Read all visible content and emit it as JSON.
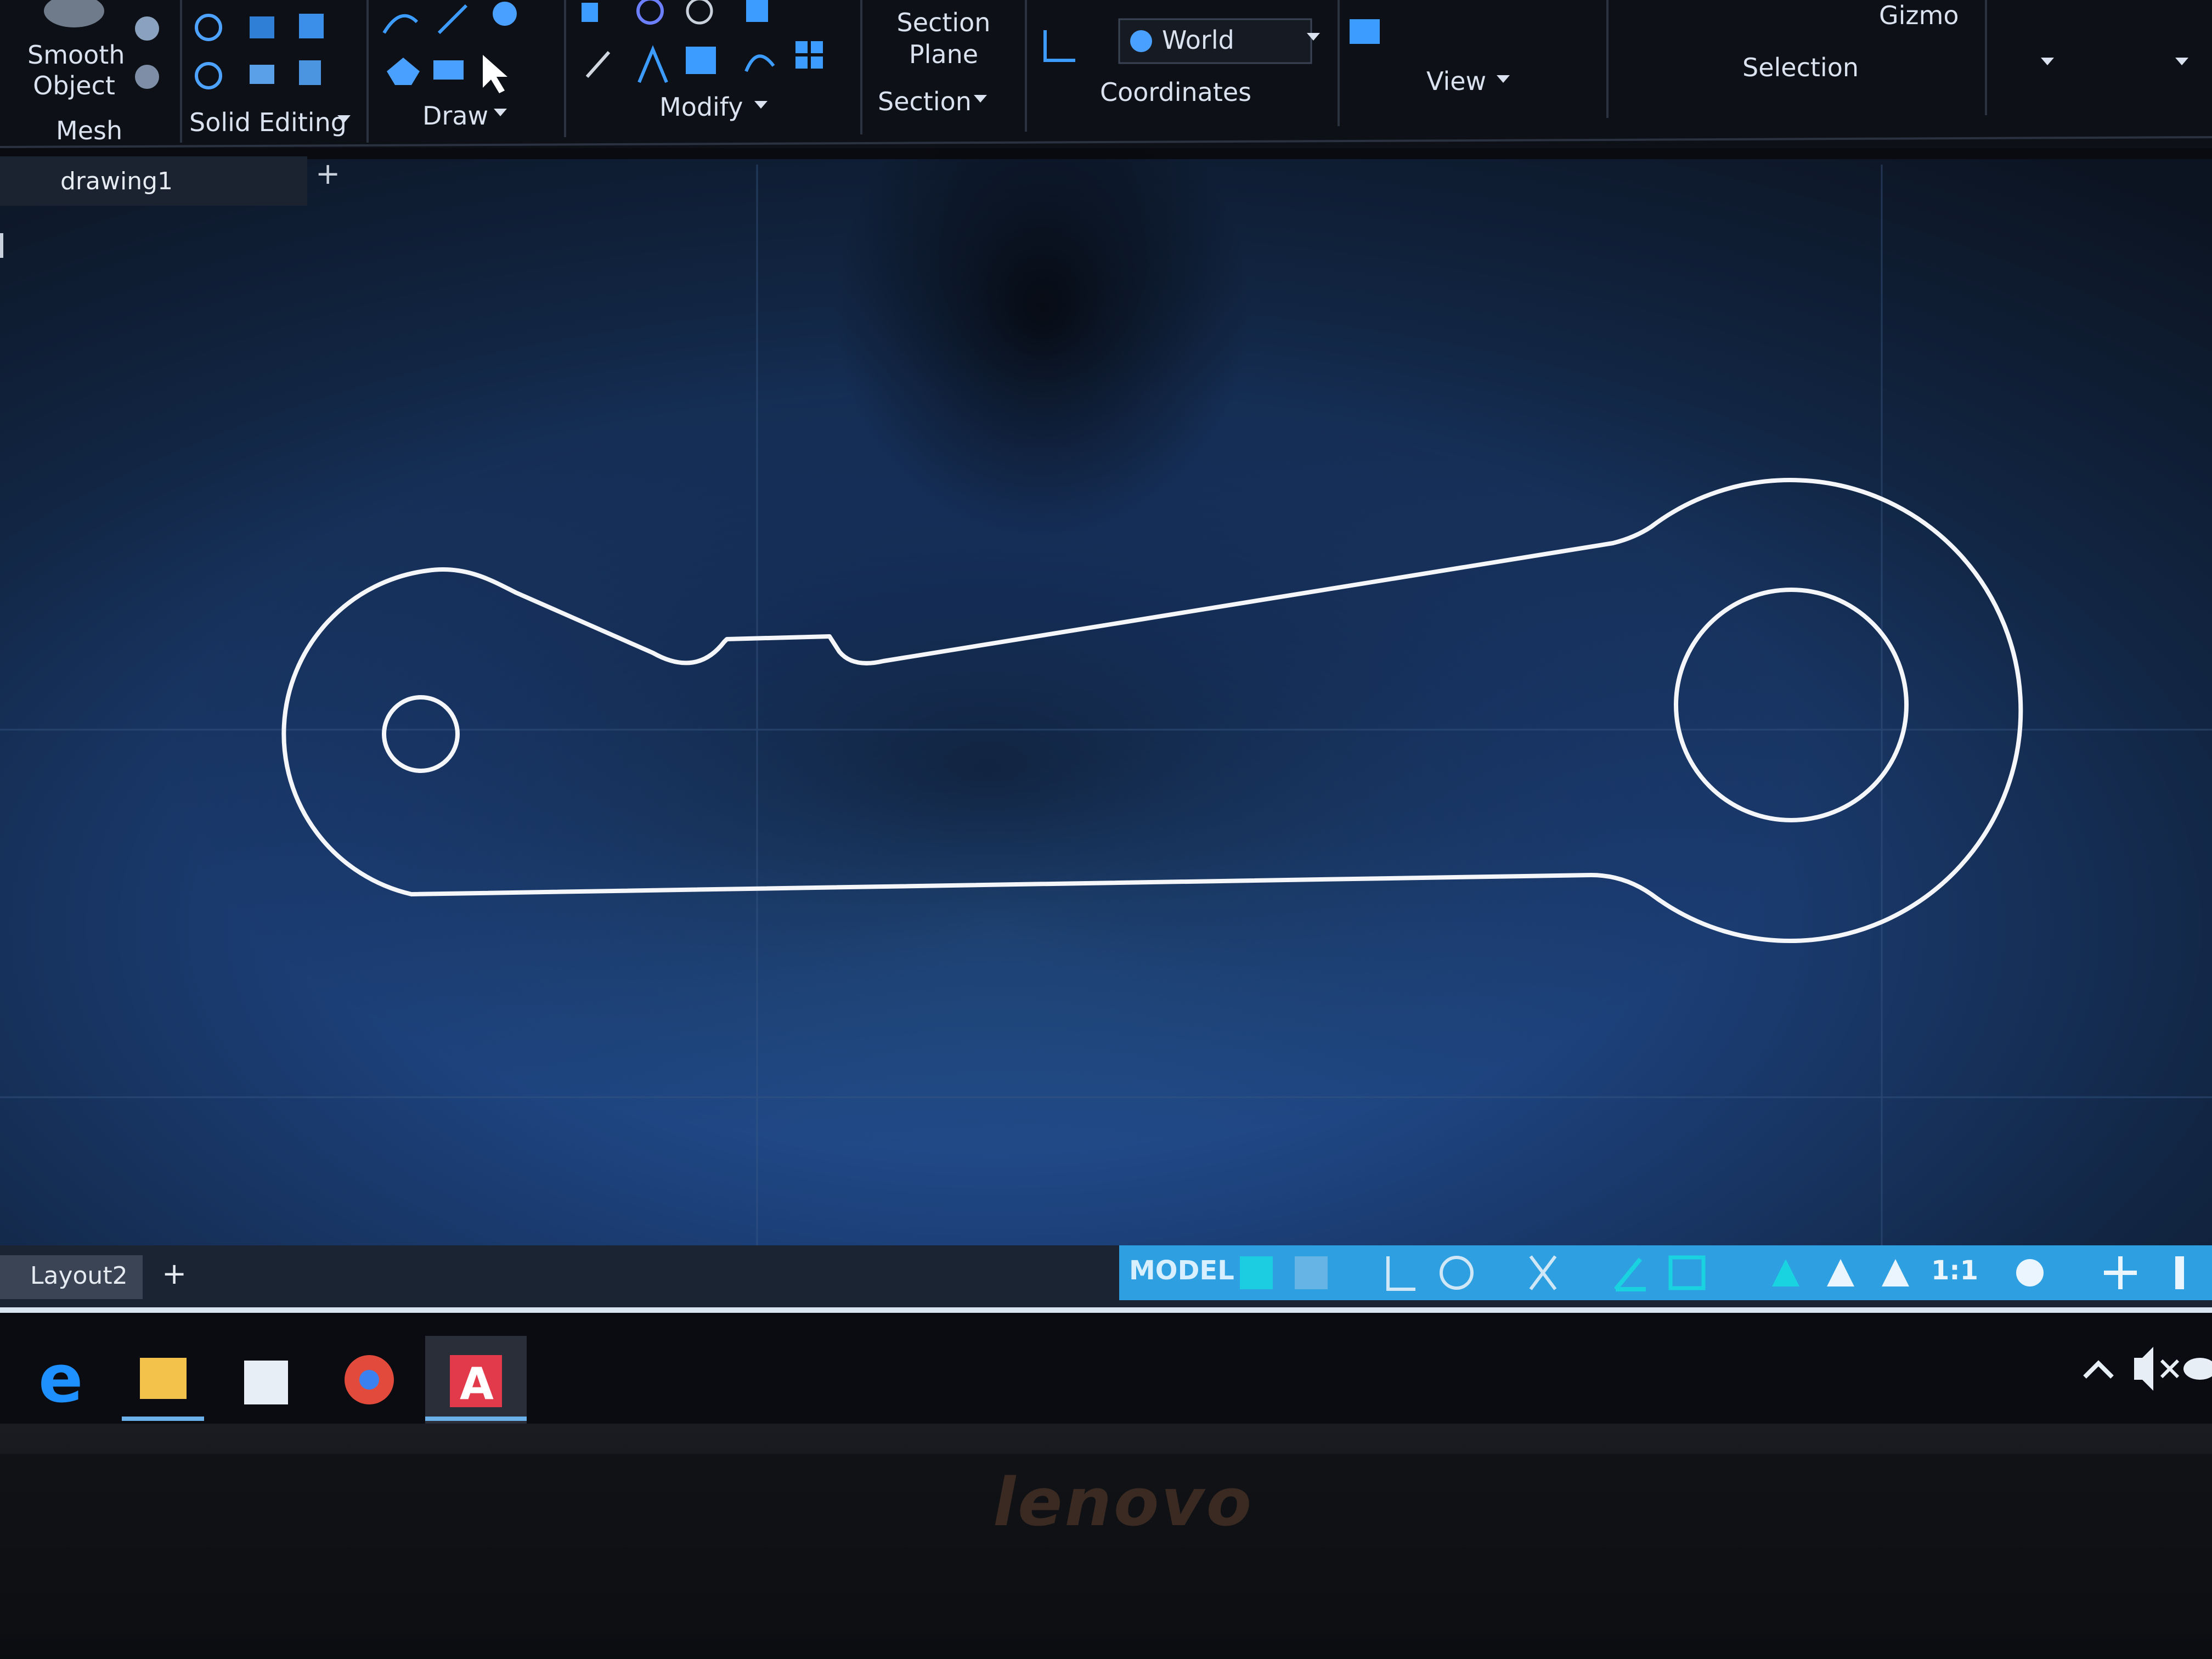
{
  "ribbon": {
    "mesh_group": {
      "button_label_line1": "Smooth",
      "button_label_line2": "Object",
      "panel_label": "Mesh"
    },
    "solid_editing_label": "Solid Editing",
    "draw_label": "Draw",
    "modify_label": "Modify",
    "section_group": {
      "button_label_line1": "Section",
      "button_label_line2": "Plane",
      "panel_label": "Section"
    },
    "coordinates_group": {
      "ucs_value": "World",
      "panel_label": "Coordinates"
    },
    "view_label": "View",
    "selection_label": "Selection",
    "gizmo_label": "Gizmo"
  },
  "file_tabs": {
    "active": "drawing1",
    "new_tab_glyph": "+"
  },
  "layout_tabs": {
    "active": "Layout2",
    "new_tab_glyph": "+"
  },
  "statusbar": {
    "model_label": "MODEL",
    "scale_label": "1:1",
    "icons": [
      "grid-icon",
      "snap-icon",
      "ortho-icon",
      "polar-icon",
      "isodraft-icon",
      "osnap-icon",
      "lineweight-icon",
      "annotation-visibility-icon",
      "autoscale-icon",
      "annotation-scale-icon",
      "workspace-gear-icon",
      "quick-properties-icon"
    ]
  },
  "taskbar": {
    "apps": [
      "edge-icon",
      "file-explorer-icon",
      "store-icon",
      "chrome-icon",
      "autocad-icon"
    ],
    "tray": [
      "chevron-up-icon",
      "volume-muted-icon",
      "cloud-icon"
    ]
  },
  "bezel": {
    "brand": "lenovo"
  },
  "colors": {
    "ribbon_bg": "#0d1016",
    "drawing_bg": "#111a2b",
    "outline": "#f4f6fa",
    "statusbar_blue": "#2e9fe0",
    "taskbar_bg": "#0a0c12",
    "accent_cyan": "#19d3e0"
  }
}
